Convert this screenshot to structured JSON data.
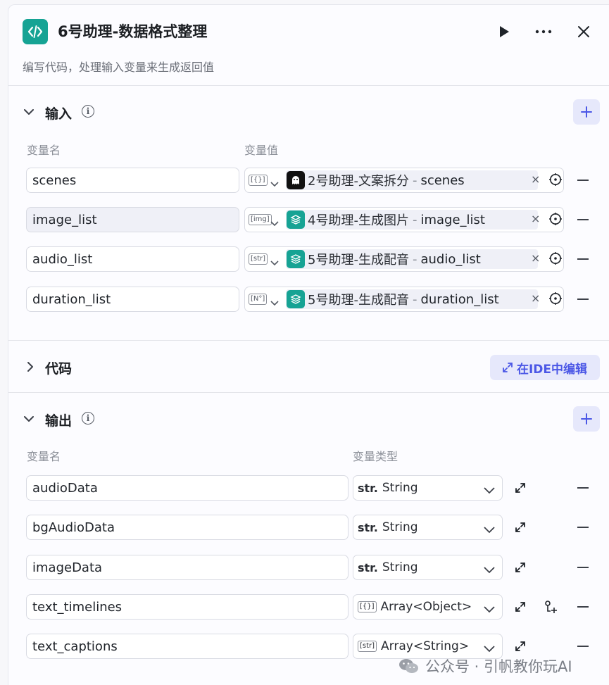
{
  "header": {
    "title": "6号助理-数据格式整理",
    "subtitle": "编写代码，处理输入变量来生成返回值",
    "icons": [
      "code-icon",
      "play-icon",
      "more-icon",
      "close-icon"
    ]
  },
  "input": {
    "title": "输入",
    "col_name": "变量名",
    "col_value": "变量值",
    "rows": [
      {
        "name": "scenes",
        "type_chip": "[{}]",
        "node": "2号助理-文案拆分",
        "sep": "-",
        "var": "scenes",
        "icon": "ghost-icon"
      },
      {
        "name": "image_list",
        "type_chip": "[img]",
        "node": "4号助理-生成图片",
        "sep": "-",
        "var": "image_list",
        "icon": "layers-icon"
      },
      {
        "name": "audio_list",
        "type_chip": "[str]",
        "node": "5号助理-生成配音",
        "sep": "-",
        "var": "audio_list",
        "icon": "layers-icon"
      },
      {
        "name": "duration_list",
        "type_chip": "[N°]",
        "node": "5号助理-生成配音",
        "sep": "-",
        "var": "duration_list",
        "icon": "layers-icon"
      }
    ]
  },
  "code": {
    "title": "代码",
    "ide_label": "在IDE中编辑"
  },
  "output": {
    "title": "输出",
    "col_name": "变量名",
    "col_type": "变量类型",
    "rows": [
      {
        "name": "audioData",
        "tag": "str.",
        "type": "String"
      },
      {
        "name": "bgAudioData",
        "tag": "str.",
        "type": "String"
      },
      {
        "name": "imageData",
        "tag": "str.",
        "type": "String"
      },
      {
        "name": "text_timelines",
        "tag": "[{}]",
        "type": "Array<Object>"
      },
      {
        "name": "text_captions",
        "tag": "[str]",
        "type": "Array<String>"
      }
    ]
  },
  "watermark": "公众号 · 引帆教你玩AI",
  "colors": {
    "accent": "#4b57e6",
    "teal": "#16a394"
  }
}
